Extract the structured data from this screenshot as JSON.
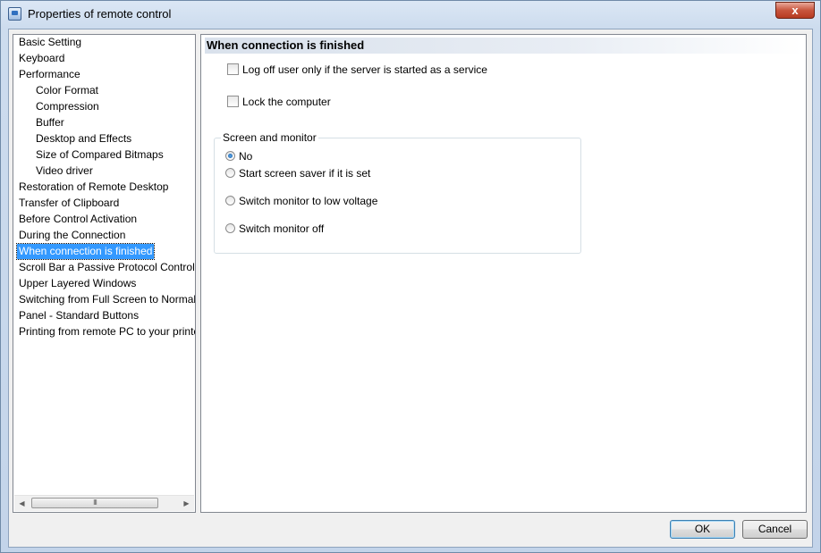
{
  "window": {
    "title": "Properties of remote control",
    "close_glyph": "x",
    "icon": "remote-control-app-icon"
  },
  "tree": {
    "items": [
      {
        "label": "Basic Setting",
        "level": 0,
        "selected": false
      },
      {
        "label": "Keyboard",
        "level": 0,
        "selected": false
      },
      {
        "label": "Performance",
        "level": 0,
        "selected": false
      },
      {
        "label": "Color Format",
        "level": 1,
        "selected": false
      },
      {
        "label": "Compression",
        "level": 1,
        "selected": false
      },
      {
        "label": "Buffer",
        "level": 1,
        "selected": false
      },
      {
        "label": "Desktop and Effects",
        "level": 1,
        "selected": false
      },
      {
        "label": "Size of Compared Bitmaps",
        "level": 1,
        "selected": false
      },
      {
        "label": "Video driver",
        "level": 1,
        "selected": false
      },
      {
        "label": "Restoration of Remote Desktop",
        "level": 0,
        "selected": false
      },
      {
        "label": "Transfer of Clipboard",
        "level": 0,
        "selected": false
      },
      {
        "label": "Before Control Activation",
        "level": 0,
        "selected": false
      },
      {
        "label": "During the Connection",
        "level": 0,
        "selected": false
      },
      {
        "label": "When connection is finished",
        "level": 0,
        "selected": true
      },
      {
        "label": "Scroll Bar a Passive Protocol Control",
        "level": 0,
        "selected": false
      },
      {
        "label": "Upper Layered Windows",
        "level": 0,
        "selected": false
      },
      {
        "label": "Switching from Full Screen to Normal",
        "level": 0,
        "selected": false
      },
      {
        "label": "Panel - Standard Buttons",
        "level": 0,
        "selected": false
      },
      {
        "label": "Printing from remote PC to your printer",
        "level": 0,
        "selected": false
      }
    ],
    "scroll_left": "◀",
    "scroll_right": "▶",
    "scroll_grip": "III"
  },
  "panel": {
    "header": "When connection is finished",
    "checkboxes": [
      {
        "label": "Log off user only if the server is started as a service",
        "checked": false
      },
      {
        "label": "Lock the computer",
        "checked": false
      }
    ],
    "group": {
      "legend": "Screen and monitor",
      "options": [
        {
          "label": "No",
          "selected": true
        },
        {
          "label": "Start screen saver if it is set",
          "selected": false
        },
        {
          "label": "Switch monitor to low voltage",
          "selected": false
        },
        {
          "label": "Switch monitor off",
          "selected": false
        }
      ]
    }
  },
  "buttons": {
    "ok": "OK",
    "cancel": "Cancel"
  }
}
